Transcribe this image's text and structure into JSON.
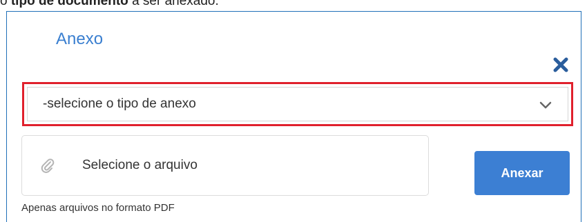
{
  "caption": {
    "prefix": "o ",
    "bold": "tipo de documento",
    "suffix": " a ser anexado."
  },
  "dialog": {
    "title": "Anexo",
    "close_icon": "close-icon"
  },
  "attachment_type_select": {
    "selected": "-selecione o tipo de anexo",
    "icon": "chevron-down-icon",
    "highlight_color": "#e0202c"
  },
  "file_picker": {
    "label": "Selecione o arquivo",
    "icon": "paperclip-icon"
  },
  "attach_button": {
    "label": "Anexar",
    "color": "#3c7fd3"
  },
  "hint": "Apenas arquivos no formato PDF",
  "colors": {
    "title": "#3a7fd0",
    "close": "#2a5d9c",
    "frame": "#1f6fb8"
  }
}
